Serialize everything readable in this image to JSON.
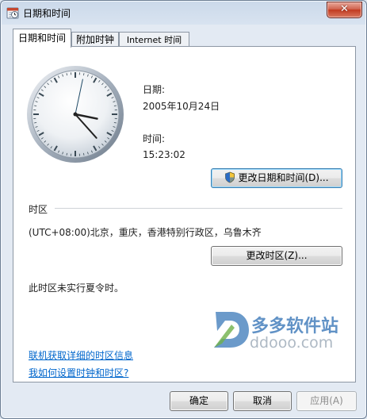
{
  "window": {
    "title": "日期和时间",
    "close_glyph": "✕"
  },
  "tabs": [
    {
      "label": "日期和时间",
      "active": true
    },
    {
      "label": "附加时钟",
      "active": false
    },
    {
      "label": "Internet 时间",
      "active": false
    }
  ],
  "date": {
    "label": "日期:",
    "value": "2005年10月24日"
  },
  "time": {
    "label": "时间:",
    "value": "15:23:02"
  },
  "change_datetime_button": "更改日期和时间(D)...",
  "timezone": {
    "section_label": "时区",
    "value": "(UTC+08:00)北京，重庆，香港特别行政区，乌鲁木齐",
    "change_button": "更改时区(Z)...",
    "dst_note": "此时区未实行夏令时。"
  },
  "links": {
    "online_info": "联机获取详细的时区信息",
    "how_to": "我如何设置时钟和时区?"
  },
  "footer": {
    "ok": "确定",
    "cancel": "取消",
    "apply": "应用(A)"
  },
  "watermark": {
    "brand": "多多软件站",
    "url": "ddooo.com"
  },
  "colors": {
    "link": "#0066cc",
    "watermark": "#3a78b8",
    "close_red": "#c13a20"
  }
}
